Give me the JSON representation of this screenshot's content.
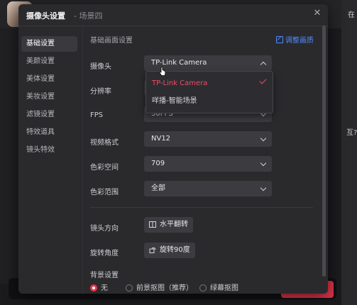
{
  "background": {
    "right_text_top": "在",
    "right_text_mid": "互?"
  },
  "dialog": {
    "title": "摄像头设置",
    "subtitle": "- 场景四",
    "close_icon": "close-icon"
  },
  "sidebar": {
    "items": [
      {
        "label": "基础设置",
        "active": true
      },
      {
        "label": "美颜设置"
      },
      {
        "label": "美体设置"
      },
      {
        "label": "美妆设置"
      },
      {
        "label": "滤镜设置"
      },
      {
        "label": "特效道具"
      },
      {
        "label": "镜头特效"
      }
    ]
  },
  "content": {
    "section_title": "基础画面设置",
    "adjust_link": "调整画质",
    "rows": {
      "camera": {
        "label": "摄像头",
        "value": "TP-Link Camera"
      },
      "resolution": {
        "label": "分辨率",
        "value": ""
      },
      "fps": {
        "label": "FPS",
        "value": "30FPS"
      },
      "video_format": {
        "label": "视频格式",
        "value": "NV12"
      },
      "color_space": {
        "label": "色彩空间",
        "value": "709"
      },
      "color_range": {
        "label": "色彩范围",
        "value": "全部"
      }
    },
    "lens_direction": {
      "label": "镜头方向",
      "button": "水平翻转"
    },
    "rotation": {
      "label": "旋转角度",
      "button": "旋转90度"
    },
    "background": {
      "label": "背景设置",
      "options": [
        {
          "label": "无",
          "selected": true
        },
        {
          "label": "前景抠图（推荐）",
          "selected": false
        },
        {
          "label": "绿幕抠图",
          "selected": false
        }
      ]
    }
  },
  "dropdown": {
    "options": [
      {
        "label": "TP-Link Camera",
        "selected": true
      },
      {
        "label": "咩播-智能场景",
        "selected": false
      }
    ]
  },
  "colors": {
    "accent_red": "#e8374e",
    "link_blue": "#4f8cff",
    "dialog_bg": "#2a2a2d"
  }
}
